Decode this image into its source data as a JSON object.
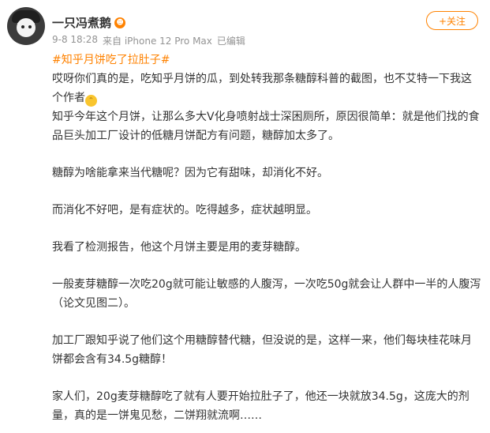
{
  "header": {
    "username": "一只冯煮鹅",
    "timestamp": "9-8 18:28",
    "source": "来自 iPhone 12 Pro Max",
    "edited": "已编辑",
    "follow_label": "+关注"
  },
  "post": {
    "hashtag": "#知乎月饼吃了拉肚子#",
    "paragraphs": [
      "哎呀你们真的是，吃知乎月饼的瓜，到处转我那条糖醇科普的截图，也不艾特一下我这个作者",
      "知乎今年这个月饼，让那么多大V化身喷射战士深困厕所，原因很简单：就是他们找的食品巨头加工厂设计的低糖月饼配方有问题，糖醇加太多了。",
      "糖醇为啥能拿来当代糖呢？因为它有甜味，却消化不好。",
      "而消化不好吧，是有症状的。吃得越多，症状越明显。",
      "我看了检测报告，他这个月饼主要是用的麦芽糖醇。",
      "一般麦芽糖醇一次吃20g就可能让敏感的人腹泻，一次吃50g就会让人群中一半的人腹泻（论文见图二）。",
      "加工厂跟知乎说了他们这个用糖醇替代糖，但没说的是，这样一来，他们每块桂花味月饼都会含有34.5g糖醇！",
      "家人们，20g麦芽糖醇吃了就有人要开始拉肚子了，他还一块就放34.5g，这庞大的剂量，真的是一饼鬼见愁，二饼翔就流啊……"
    ],
    "emoji_icon": "grinning-sweat-emoji"
  }
}
